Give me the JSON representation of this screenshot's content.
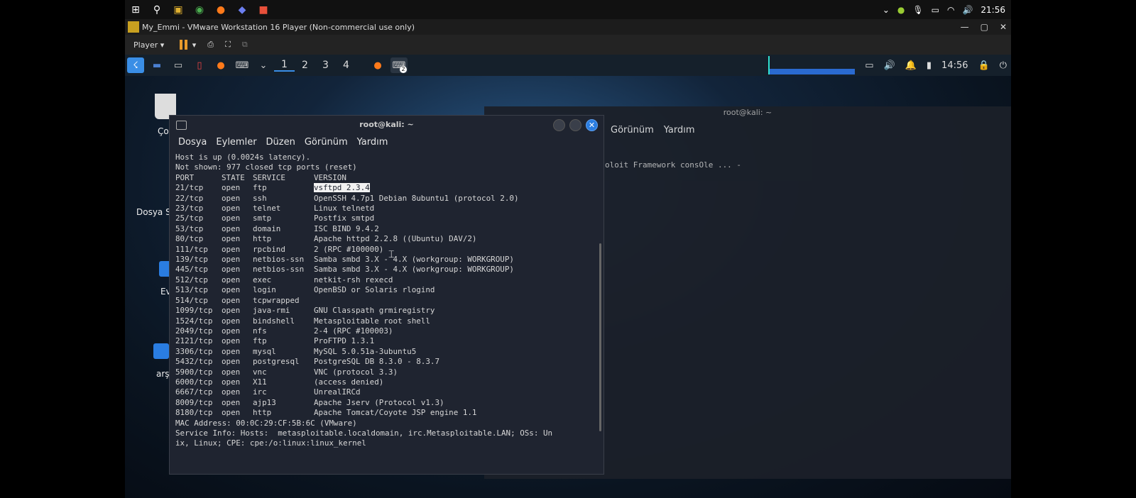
{
  "host": {
    "clock": "21:56",
    "vm_title": "My_Emmi - VMware Workstation 16 Player (Non-commercial use only)",
    "player_label": "Player"
  },
  "kali": {
    "workspaces": [
      "1",
      "2",
      "3",
      "4"
    ],
    "clock": "14:56",
    "badge": "2"
  },
  "desktop": {
    "items": [
      "Ço",
      "Dosya S",
      "Ev",
      "arş"
    ]
  },
  "bg_terminal": {
    "title": "root@kali: ~",
    "menu": [
      "Görünüm",
      "Yardım"
    ],
    "line": "oloit Framework consOle ... -"
  },
  "terminal": {
    "title": "root@kali: ~",
    "menu": [
      "Dosya",
      "Eylemler",
      "Düzen",
      "Görünüm",
      "Yardım"
    ],
    "pre_lines": [
      "Host is up (0.0024s latency).",
      "Not shown: 977 closed tcp ports (reset)"
    ],
    "header": {
      "port": "PORT",
      "state": "STATE",
      "service": "SERVICE",
      "version": "VERSION"
    },
    "rows": [
      {
        "port": "21/tcp",
        "state": "open",
        "service": "ftp",
        "version": "vsftpd 2.3.4"
      },
      {
        "port": "22/tcp",
        "state": "open",
        "service": "ssh",
        "version": "OpenSSH 4.7p1 Debian 8ubuntu1 (protocol 2.0)"
      },
      {
        "port": "23/tcp",
        "state": "open",
        "service": "telnet",
        "version": "Linux telnetd"
      },
      {
        "port": "25/tcp",
        "state": "open",
        "service": "smtp",
        "version": "Postfix smtpd"
      },
      {
        "port": "53/tcp",
        "state": "open",
        "service": "domain",
        "version": "ISC BIND 9.4.2"
      },
      {
        "port": "80/tcp",
        "state": "open",
        "service": "http",
        "version": "Apache httpd 2.2.8 ((Ubuntu) DAV/2)"
      },
      {
        "port": "111/tcp",
        "state": "open",
        "service": "rpcbind",
        "version": "2 (RPC #100000)"
      },
      {
        "port": "139/tcp",
        "state": "open",
        "service": "netbios-ssn",
        "version": "Samba smbd 3.X - 4.X (workgroup: WORKGROUP)"
      },
      {
        "port": "445/tcp",
        "state": "open",
        "service": "netbios-ssn",
        "version": "Samba smbd 3.X - 4.X (workgroup: WORKGROUP)"
      },
      {
        "port": "512/tcp",
        "state": "open",
        "service": "exec",
        "version": "netkit-rsh rexecd"
      },
      {
        "port": "513/tcp",
        "state": "open",
        "service": "login",
        "version": "OpenBSD or Solaris rlogind"
      },
      {
        "port": "514/tcp",
        "state": "open",
        "service": "tcpwrapped",
        "version": ""
      },
      {
        "port": "1099/tcp",
        "state": "open",
        "service": "java-rmi",
        "version": "GNU Classpath grmiregistry"
      },
      {
        "port": "1524/tcp",
        "state": "open",
        "service": "bindshell",
        "version": "Metasploitable root shell"
      },
      {
        "port": "2049/tcp",
        "state": "open",
        "service": "nfs",
        "version": "2-4 (RPC #100003)"
      },
      {
        "port": "2121/tcp",
        "state": "open",
        "service": "ftp",
        "version": "ProFTPD 1.3.1"
      },
      {
        "port": "3306/tcp",
        "state": "open",
        "service": "mysql",
        "version": "MySQL 5.0.51a-3ubuntu5"
      },
      {
        "port": "5432/tcp",
        "state": "open",
        "service": "postgresql",
        "version": "PostgreSQL DB 8.3.0 - 8.3.7"
      },
      {
        "port": "5900/tcp",
        "state": "open",
        "service": "vnc",
        "version": "VNC (protocol 3.3)"
      },
      {
        "port": "6000/tcp",
        "state": "open",
        "service": "X11",
        "version": "(access denied)"
      },
      {
        "port": "6667/tcp",
        "state": "open",
        "service": "irc",
        "version": "UnrealIRCd"
      },
      {
        "port": "8009/tcp",
        "state": "open",
        "service": "ajp13",
        "version": "Apache Jserv (Protocol v1.3)"
      },
      {
        "port": "8180/tcp",
        "state": "open",
        "service": "http",
        "version": "Apache Tomcat/Coyote JSP engine 1.1"
      }
    ],
    "post_lines": [
      "MAC Address: 00:0C:29:CF:5B:6C (VMware)",
      "Service Info: Hosts:  metasploitable.localdomain, irc.Metasploitable.LAN; OSs: Un",
      "ix, Linux; CPE: cpe:/o:linux:linux_kernel"
    ]
  }
}
